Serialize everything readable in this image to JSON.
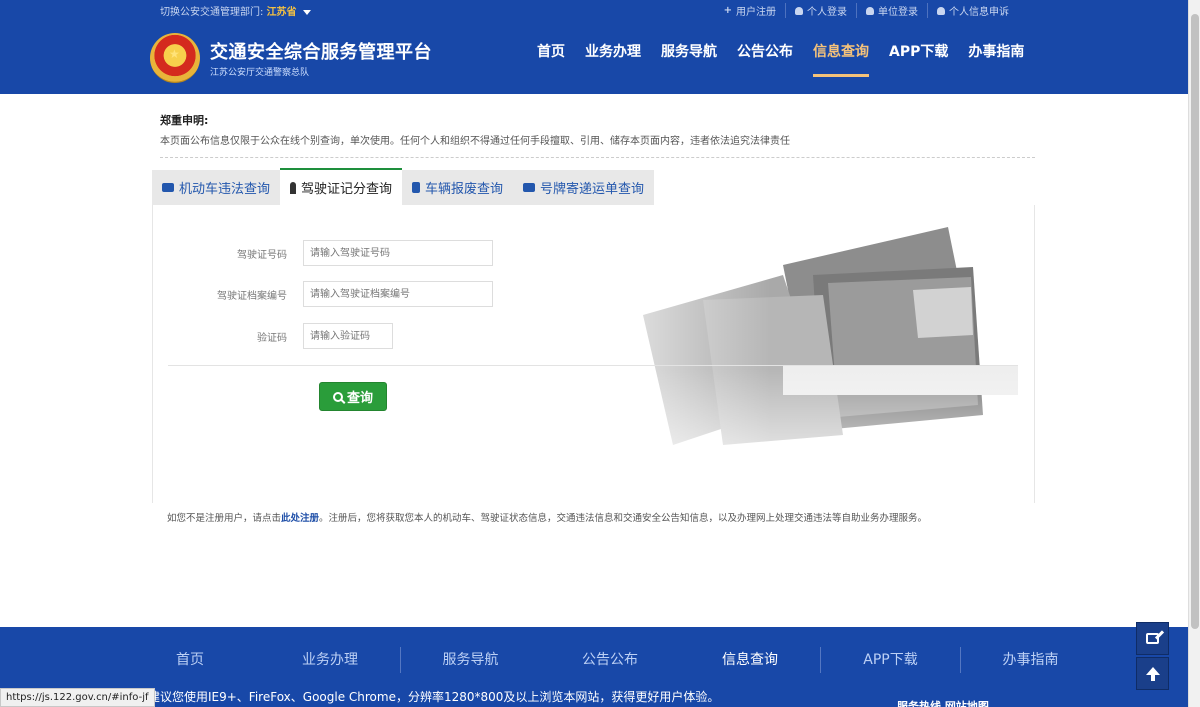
{
  "topbar": {
    "region_label": "切换公安交通管理部门:",
    "region_value": "江苏省",
    "links": [
      "用户注册",
      "个人登录",
      "单位登录",
      "个人信息申诉"
    ]
  },
  "header": {
    "title": "交通安全综合服务管理平台",
    "subtitle": "江苏公安厅交通警察总队",
    "nav": [
      "首页",
      "业务办理",
      "服务导航",
      "公告公布",
      "信息查询",
      "APP下载",
      "办事指南"
    ],
    "active_nav": "信息查询"
  },
  "notice": {
    "title": "郑重申明:",
    "text": "本页面公布信息仅限于公众在线个别查询，单次使用。任何个人和组织不得通过任何手段擅取、引用、储存本页面内容，违者依法追究法律责任"
  },
  "tabs": [
    "机动车违法查询",
    "驾驶证记分查询",
    "车辆报废查询",
    "号牌寄递运单查询"
  ],
  "form": {
    "license_label": "驾驶证号码",
    "license_placeholder": "请输入驾驶证号码",
    "archive_label": "驾驶证档案编号",
    "archive_placeholder": "请输入驾驶证档案编号",
    "captcha_label": "验证码",
    "captcha_placeholder": "请输入验证码",
    "query_button": "查询"
  },
  "hint": {
    "prefix": "如您不是注册用户，请点击",
    "link": "此处注册",
    "suffix": "。注册后，您将获取您本人的机动车、驾驶证状态信息，交通违法信息和交通安全公告知信息，以及办理网上处理交通违法等自助业务办理服务。"
  },
  "footer": {
    "nav": [
      "首页",
      "业务办理",
      "服务导航",
      "公告公布",
      "信息查询",
      "APP下载",
      "办事指南"
    ],
    "note": "建议您使用IE9+、FireFox、Google Chrome，分辨率1280*800及以上浏览本网站，获得更好用户体验。",
    "extra": "服务热线  网站地图"
  },
  "statusbar": "https://js.122.gov.cn/#info-jf",
  "colors": {
    "brand_blue": "#1848a8",
    "accent_orange": "#f5c37a",
    "button_green": "#2a9d3a"
  }
}
